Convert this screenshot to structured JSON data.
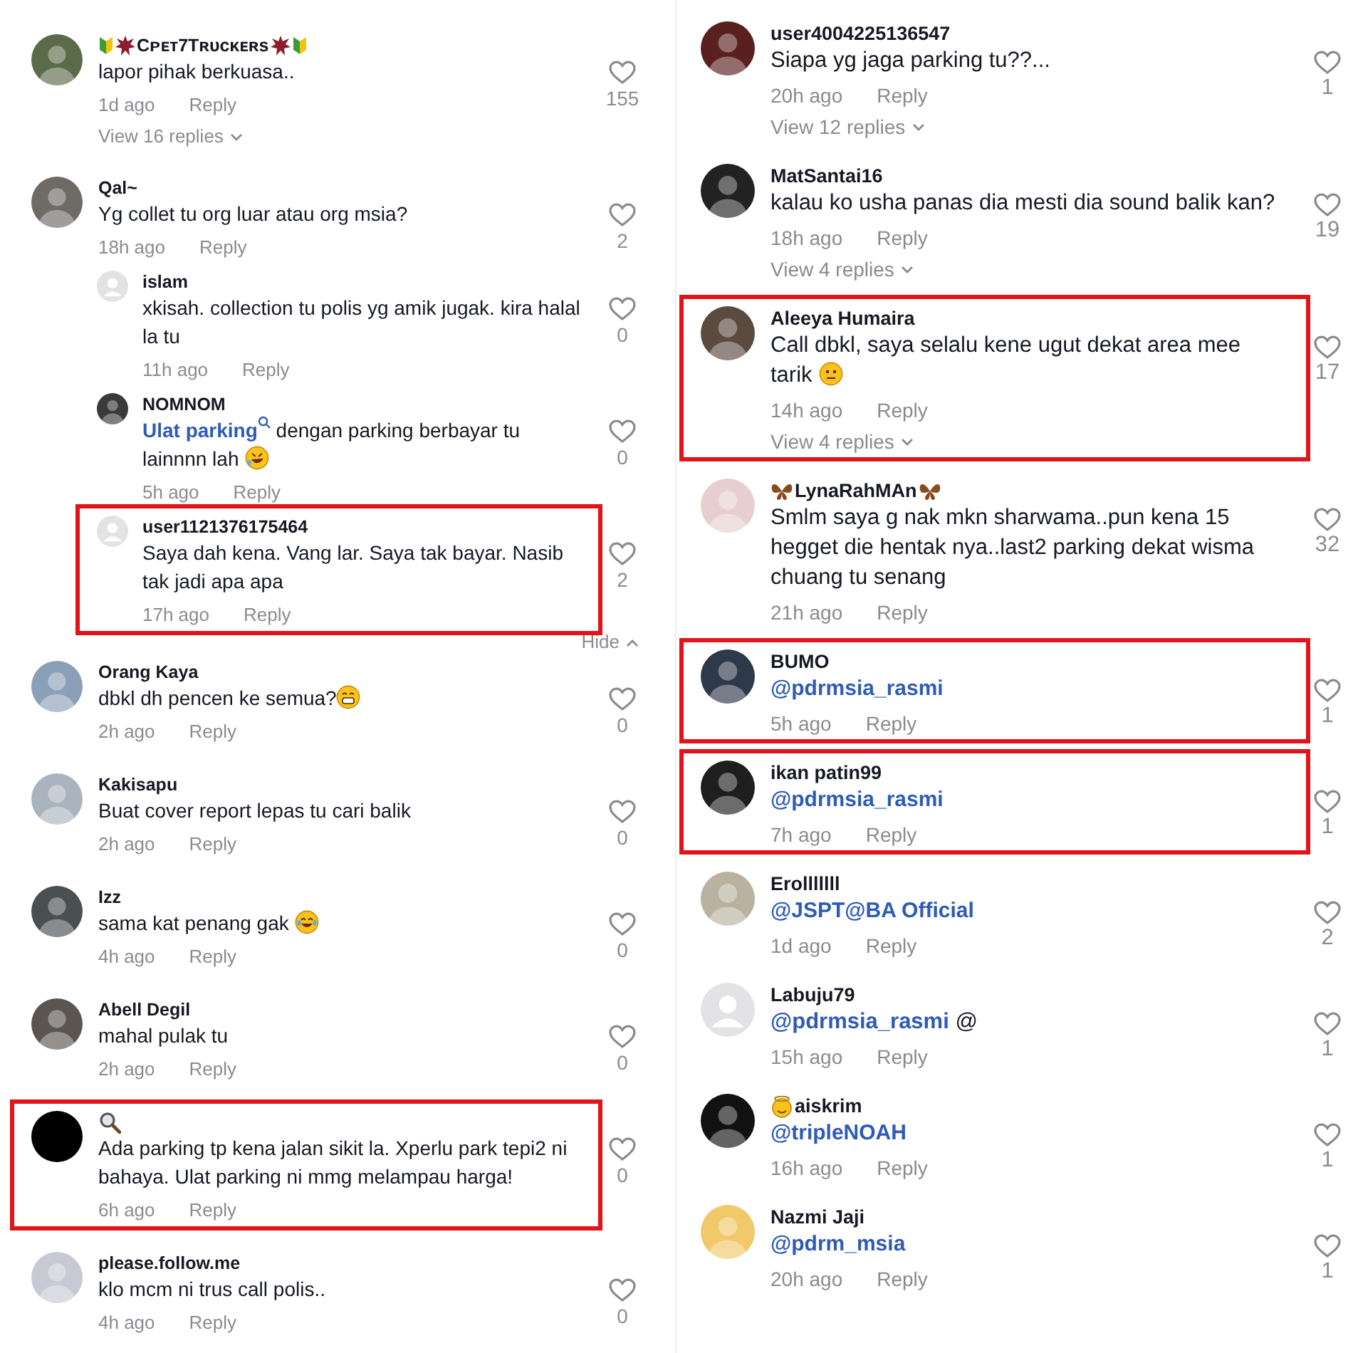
{
  "columns": [
    {
      "comments": [
        {
          "avatar": {
            "kind": "photo",
            "color": "#5b6b4a"
          },
          "name_before": [
            {
              "kind": "shield"
            },
            {
              "kind": "burst"
            }
          ],
          "name": "Cᴘᴇᴛ7Tʀᴜᴄᴋᴇʀs",
          "name_after": [
            {
              "kind": "burst"
            },
            {
              "kind": "shield"
            }
          ],
          "text": [
            {
              "kind": "plain",
              "text": "lapor pihak berkuasa.."
            }
          ],
          "time": "1d ago",
          "reply": "Reply",
          "likes": "155",
          "view_replies": "View 16 replies",
          "highlighted": false
        },
        {
          "avatar": {
            "kind": "photo",
            "color": "#6e6a66"
          },
          "name": "Qal~",
          "text": [
            {
              "kind": "plain",
              "text": "Yg collet tu org luar atau org msia?"
            }
          ],
          "time": "18h ago",
          "reply": "Reply",
          "likes": "2",
          "highlighted": false,
          "hide": "Hide",
          "children": [
            {
              "avatar": {
                "kind": "default"
              },
              "name": "islam",
              "text": [
                {
                  "kind": "plain",
                  "text": "xkisah. collection tu polis yg amik jugak. kira halal la tu"
                }
              ],
              "time": "11h ago",
              "reply": "Reply",
              "likes": "0",
              "highlighted": false
            },
            {
              "avatar": {
                "kind": "photo",
                "color": "#3a3a3a"
              },
              "name": "NOMNOM",
              "text": [
                {
                  "kind": "mention",
                  "text": "Ulat parking"
                },
                {
                  "kind": "search"
                },
                {
                  "kind": "plain",
                  "text": " dengan parking berbayar tu lainnnn lah "
                },
                {
                  "kind": "rofl"
                }
              ],
              "time": "5h ago",
              "reply": "Reply",
              "likes": "0",
              "highlighted": false
            },
            {
              "avatar": {
                "kind": "default"
              },
              "name": "user1121376175464",
              "text": [
                {
                  "kind": "plain",
                  "text": "Saya dah kena. Vang lar. Saya tak bayar. Nasib tak jadi apa apa"
                }
              ],
              "time": "17h ago",
              "reply": "Reply",
              "likes": "2",
              "highlighted": true
            }
          ]
        },
        {
          "avatar": {
            "kind": "photo",
            "color": "#8aa0b8"
          },
          "name": "Orang Kaya",
          "text": [
            {
              "kind": "plain",
              "text": "dbkl dh pencen ke semua?"
            },
            {
              "kind": "grin"
            }
          ],
          "time": "2h ago",
          "reply": "Reply",
          "likes": "0",
          "highlighted": false
        },
        {
          "avatar": {
            "kind": "photo",
            "color": "#a9b4bf"
          },
          "name": "Kakisapu",
          "text": [
            {
              "kind": "plain",
              "text": "Buat cover report lepas tu cari balik"
            }
          ],
          "time": "2h ago",
          "reply": "Reply",
          "likes": "0",
          "highlighted": false
        },
        {
          "avatar": {
            "kind": "photo",
            "color": "#4a4f52"
          },
          "name": "Izz",
          "text": [
            {
              "kind": "plain",
              "text": "sama kat penang gak "
            },
            {
              "kind": "tears"
            }
          ],
          "time": "4h ago",
          "reply": "Reply",
          "likes": "0",
          "highlighted": false
        },
        {
          "avatar": {
            "kind": "photo",
            "color": "#5a5550"
          },
          "name": "Abell Degil",
          "text": [
            {
              "kind": "plain",
              "text": "mahal pulak tu"
            }
          ],
          "time": "2h ago",
          "reply": "Reply",
          "likes": "0",
          "highlighted": false
        },
        {
          "avatar": {
            "kind": "blank",
            "color": "#000000"
          },
          "name_before": [
            {
              "kind": "magnifier"
            }
          ],
          "text": [
            {
              "kind": "plain",
              "text": "Ada parking tp kena jalan sikit la. Xperlu park tepi2 ni bahaya. Ulat parking ni mmg melampau harga!"
            }
          ],
          "time": "6h ago",
          "reply": "Reply",
          "likes": "0",
          "highlighted": true
        },
        {
          "avatar": {
            "kind": "photo",
            "color": "#c9c9d6"
          },
          "name": "please.follow.me",
          "text": [
            {
              "kind": "plain",
              "text": "klo mcm ni trus call polis.."
            }
          ],
          "time": "4h ago",
          "reply": "Reply",
          "likes": "0",
          "highlighted": false
        }
      ]
    },
    {
      "comments": [
        {
          "avatar": {
            "kind": "photo",
            "color": "#5a2020"
          },
          "name": "user4004225136547",
          "text": [
            {
              "kind": "plain",
              "text": "Siapa yg jaga parking tu??..."
            }
          ],
          "time": "20h ago",
          "reply": "Reply",
          "likes": "1",
          "view_replies": "View 12 replies",
          "highlighted": false
        },
        {
          "avatar": {
            "kind": "photo",
            "color": "#222222"
          },
          "name": "MatSantai16",
          "text": [
            {
              "kind": "plain",
              "text": "kalau ko usha panas dia mesti dia sound balik kan?"
            }
          ],
          "time": "18h ago",
          "reply": "Reply",
          "likes": "19",
          "view_replies": "View 4 replies",
          "highlighted": false
        },
        {
          "avatar": {
            "kind": "photo",
            "color": "#5a4a40"
          },
          "name": "Aleeya Humaira",
          "text": [
            {
              "kind": "plain",
              "text": "Call dbkl, saya selalu kene ugut dekat area mee tarik "
            },
            {
              "kind": "neutral"
            }
          ],
          "time": "14h ago",
          "reply": "Reply",
          "likes": "17",
          "view_replies": "View 4 replies",
          "highlighted": true
        },
        {
          "avatar": {
            "kind": "photo",
            "color": "#e8cfcf"
          },
          "name_before": [
            {
              "kind": "butterfly"
            }
          ],
          "name": "LynaRahMAn",
          "name_after": [
            {
              "kind": "butterfly"
            }
          ],
          "text": [
            {
              "kind": "plain",
              "text": "Smlm saya g nak mkn sharwama..pun kena 15 hegget die hentak nya..last2 parking dekat wisma chuang tu senang"
            }
          ],
          "time": "21h ago",
          "reply": "Reply",
          "likes": "32",
          "highlighted": false
        },
        {
          "avatar": {
            "kind": "photo",
            "color": "#2e3a4a"
          },
          "name": "BUMO",
          "text": [
            {
              "kind": "mention",
              "text": "@pdrmsia_rasmi"
            }
          ],
          "time": "5h ago",
          "reply": "Reply",
          "likes": "1",
          "highlighted": true
        },
        {
          "avatar": {
            "kind": "photo",
            "color": "#1e1e1e"
          },
          "name": "ikan patin99",
          "text": [
            {
              "kind": "mention",
              "text": "@pdrmsia_rasmi"
            }
          ],
          "time": "7h ago",
          "reply": "Reply",
          "likes": "1",
          "highlighted": true
        },
        {
          "avatar": {
            "kind": "photo",
            "color": "#b9b2a0"
          },
          "name": "Erolllllll",
          "text": [
            {
              "kind": "mention",
              "text": "@JSPT@BA Official"
            }
          ],
          "time": "1d ago",
          "reply": "Reply",
          "likes": "2",
          "highlighted": false
        },
        {
          "avatar": {
            "kind": "default"
          },
          "name": "Labuju79",
          "text": [
            {
              "kind": "mention",
              "text": "@pdrmsia_rasmi"
            },
            {
              "kind": "plain",
              "text": " @"
            }
          ],
          "time": "15h ago",
          "reply": "Reply",
          "likes": "1",
          "highlighted": false
        },
        {
          "avatar": {
            "kind": "photo",
            "color": "#111111"
          },
          "name_before": [
            {
              "kind": "halo-face"
            }
          ],
          "name": "aiskrim",
          "text": [
            {
              "kind": "mention",
              "text": "@tripleNOAH"
            }
          ],
          "time": "16h ago",
          "reply": "Reply",
          "likes": "1",
          "highlighted": false
        },
        {
          "avatar": {
            "kind": "photo",
            "color": "#f1c86a"
          },
          "name": "Nazmi Jaji",
          "text": [
            {
              "kind": "mention",
              "text": "@pdrm_msia"
            }
          ],
          "time": "20h ago",
          "reply": "Reply",
          "likes": "1",
          "highlighted": false
        }
      ]
    }
  ]
}
